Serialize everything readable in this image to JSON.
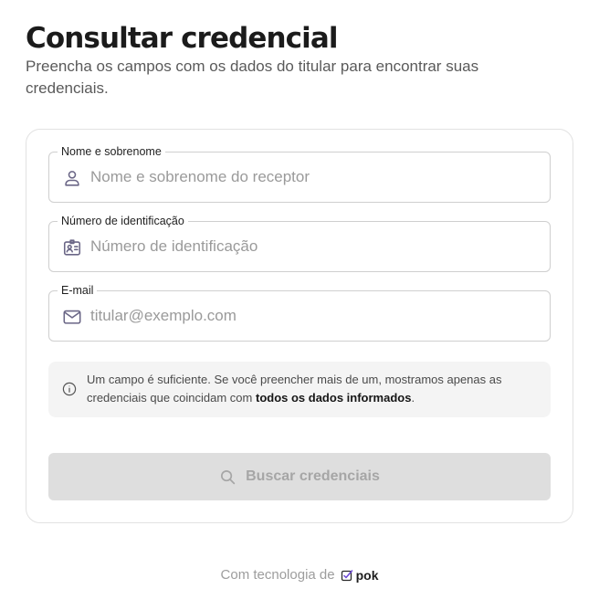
{
  "header": {
    "title": "Consultar credencial",
    "subtitle": "Preencha os campos com os dados do titular para encontrar suas credenciais."
  },
  "form": {
    "name_field": {
      "label": "Nome e sobrenome",
      "placeholder": "Nome e sobrenome do receptor",
      "value": "",
      "icon": "user-icon"
    },
    "id_field": {
      "label": "Número de identificação",
      "placeholder": "Número de identificação",
      "value": "",
      "icon": "id-card-icon"
    },
    "email_field": {
      "label": "E-mail",
      "placeholder": "titular@exemplo.com",
      "value": "",
      "icon": "mail-icon"
    },
    "info": {
      "icon": "info-icon",
      "text_before": "Um campo é suficiente. Se você preencher mais de um, mostramos apenas as credenciais que coincidam com ",
      "text_bold": "todos os dados informados",
      "text_after": "."
    },
    "submit": {
      "label": "Buscar credenciais",
      "icon": "search-icon",
      "disabled": true
    }
  },
  "footer": {
    "powered_by": "Com tecnologia de",
    "brand": "pok",
    "brand_icon": "pok-logo-icon"
  },
  "colors": {
    "title": "#1b1b1b",
    "subtitle": "#5a5a5a",
    "field_border": "#cfcfcf",
    "placeholder": "#9a9a9a",
    "icon": "#6a6686",
    "info_bg": "#f4f4f4",
    "button_disabled_bg": "#dedede",
    "button_disabled_text": "#a6a6a6",
    "brand_accent": "#6b47d6"
  }
}
